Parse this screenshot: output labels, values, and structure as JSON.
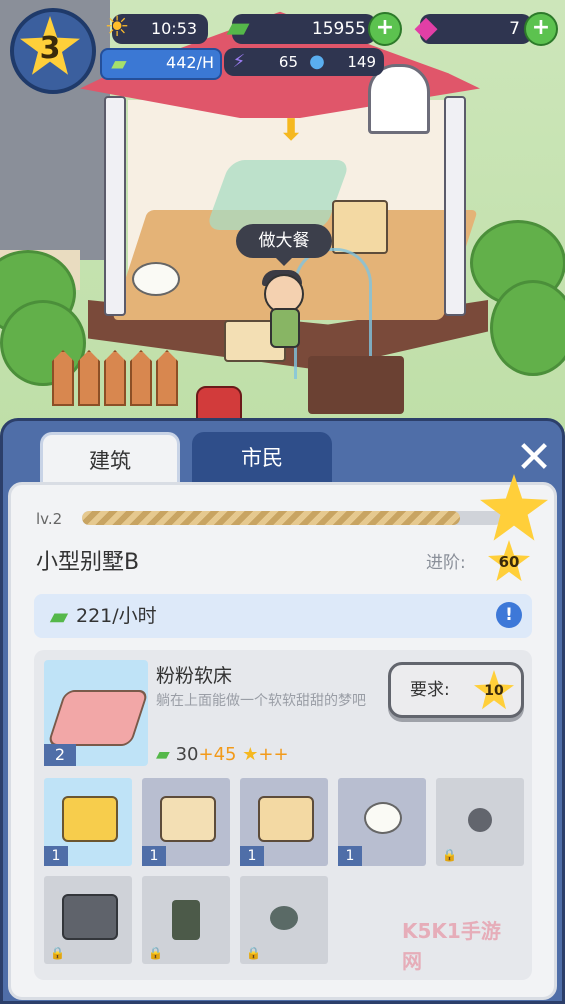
{
  "hud": {
    "level": "3",
    "time": "10:53",
    "cash": "15955",
    "gems": "7",
    "income": "442/H",
    "energy": "65",
    "water": "149",
    "icons": {
      "time": "sun-icon",
      "cash": "cash-icon",
      "gems": "gem-icon",
      "income": "cash-icon",
      "energy": "energy-icon",
      "water": "water-drop-icon",
      "add": "plus-icon"
    }
  },
  "scene": {
    "speech_bubble": "做大餐"
  },
  "panel": {
    "tabs": [
      {
        "label": "建筑",
        "active": true
      },
      {
        "label": "市民",
        "active": false
      }
    ],
    "level_label": "lv.2",
    "level_progress": 0.9,
    "building_name": "小型别墅B",
    "advance_label": "进阶:",
    "advance_requirement": "60",
    "income_rate": "221/小时",
    "featured_item": {
      "name": "粉粉软床",
      "description": "躺在上面能做一个软软甜甜的梦吧",
      "level": "2",
      "income_value": "30",
      "income_bonus": "+45",
      "star_bonus": "++",
      "require_label": "要求:",
      "require_value": "10"
    },
    "slots": [
      {
        "item": "yellow-bed",
        "state": "selected",
        "level": "1"
      },
      {
        "item": "side-table",
        "state": "unlocked",
        "level": "1"
      },
      {
        "item": "desk",
        "state": "unlocked",
        "level": "1"
      },
      {
        "item": "toilet",
        "state": "unlocked",
        "level": "1"
      },
      {
        "item": "item-silhouette",
        "state": "locked",
        "level": ""
      },
      {
        "item": "speaker",
        "state": "locked",
        "level": ""
      },
      {
        "item": "potted-plant",
        "state": "locked",
        "level": ""
      },
      {
        "item": "stool",
        "state": "locked",
        "level": ""
      }
    ]
  },
  "watermark": "K5K1手游网",
  "colors": {
    "panel_blue": "#4f6ea8",
    "accent_gold": "#ffcf3a",
    "cash_green": "#55b84a",
    "bonus_orange": "#f29a1a"
  }
}
